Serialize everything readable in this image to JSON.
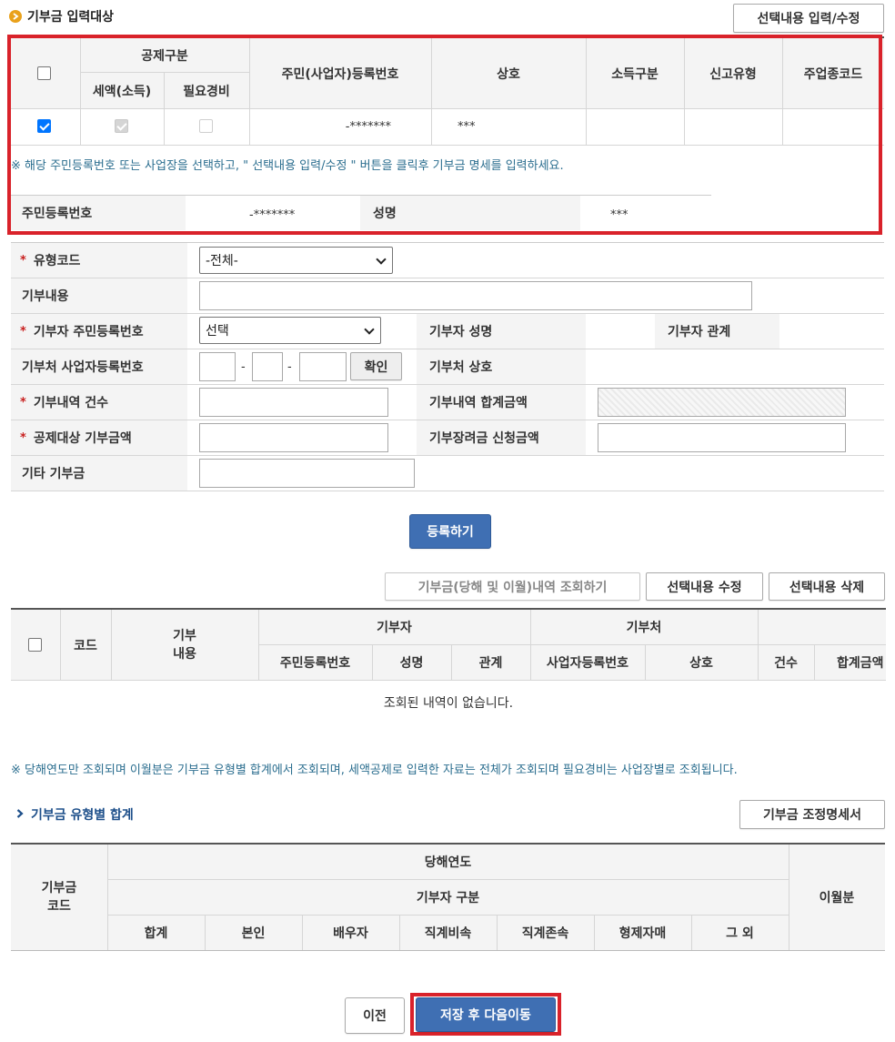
{
  "section_title": "기부금 입력대상",
  "btn_select_input": "선택내용 입력/수정",
  "target_table": {
    "group_header": "공제구분",
    "sub_headers": [
      "세액(소득)",
      "필요경비"
    ],
    "columns": [
      "주민(사업자)등록번호",
      "상호",
      "소득구분",
      "신고유형",
      "주업종코드"
    ],
    "row": {
      "reg_no": "-*******",
      "name": "***",
      "checked": true,
      "tax_checked": true,
      "expense_checked": false
    }
  },
  "target_note": "※ 해당 주민등록번호 또는 사업장을 선택하고, \" 선택내용 입력/수정 \"  버튼을 클릭후 기부금 명세를 입력하세요.",
  "resident": {
    "label": "주민등록번호",
    "value": "-*******",
    "name_label": "성명",
    "name_value": "***"
  },
  "form": {
    "type_code_label": "유형코드",
    "type_code_value": "-전체-",
    "content_label": "기부내용",
    "donor_reg_label": "기부자 주민등록번호",
    "donor_reg_value": "선택",
    "donor_name_label": "기부자 성명",
    "donor_relation_label": "기부자 관계",
    "biz_reg_label": "기부처 사업자등록번호",
    "dash": "-",
    "confirm_label": "확인",
    "biz_name_label": "기부처 상호",
    "count_label": "기부내역 건수",
    "total_label": "기부내역 합계금액",
    "deduct_label": "공제대상 기부금액",
    "incentive_label": "기부장려금 신청금액",
    "etc_label": "기타 기부금",
    "required_mark": "*"
  },
  "btn_register": "등록하기",
  "btn_query": "기부금(당해 및 이월)내역 조회하기",
  "btn_edit": "선택내용 수정",
  "btn_delete": "선택내용 삭제",
  "list_table": {
    "code": "코드",
    "content": "기부\n내용",
    "donor_group": "기부자",
    "donor_cols": [
      "주민등록번호",
      "성명",
      "관계"
    ],
    "place_group": "기부처",
    "place_cols": [
      "사업자등록번호",
      "상호"
    ],
    "count": "건수",
    "total": "합계금액",
    "empty": "조회된 내역이 없습니다."
  },
  "list_note": "※ 당해연도만 조회되며 이월분은 기부금 유형별 합계에서 조회되며, 세액공제로 입력한 자료는 전체가 조회되며 필요경비는 사업장별로 조회됩니다.",
  "summary_title": "기부금 유형별 합계",
  "btn_adjust": "기부금 조정명세서",
  "summary_table": {
    "code": "기부금\n코드",
    "year": "당해연도",
    "donor_type": "기부자 구분",
    "cols": [
      "합계",
      "본인",
      "배우자",
      "직계비속",
      "직계존속",
      "형제자매",
      "그 외"
    ],
    "carry": "이월분"
  },
  "btn_prev": "이전",
  "btn_save_next": "저장 후 다음이동",
  "colors": {
    "accent_blue": "#3f6fb3",
    "highlight_red": "#d9222a",
    "note_teal": "#2b6e8f"
  }
}
